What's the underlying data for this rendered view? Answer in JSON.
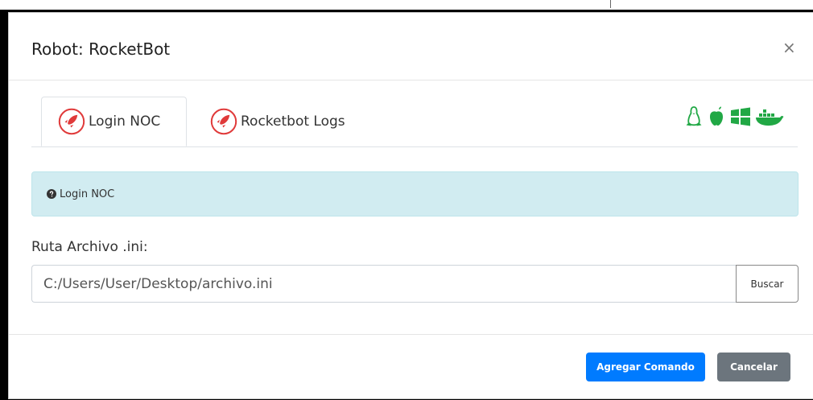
{
  "modal": {
    "title": "Robot: RocketBot",
    "close_glyph": "×"
  },
  "tabs": [
    {
      "label": "Login NOC",
      "icon": "rocket-icon",
      "active": true
    },
    {
      "label": "Rocketbot Logs",
      "icon": "rocket-icon",
      "active": false
    }
  ],
  "os_icons": [
    "linux-icon",
    "apple-icon",
    "windows-icon",
    "docker-icon"
  ],
  "alert": {
    "text": "Login NOC",
    "icon": "question-circle-icon"
  },
  "field": {
    "label": "Ruta Archivo .ini:",
    "value": "C:/Users/User/Desktop/archivo.ini",
    "button": "Buscar"
  },
  "footer": {
    "primary": "Agregar Comando",
    "secondary": "Cancelar"
  },
  "colors": {
    "primary": "#007bff",
    "secondary": "#6c757d",
    "alert_background": "#d1ecf1",
    "rocket_red": "#e03a3a",
    "os_green": "#21a845"
  }
}
